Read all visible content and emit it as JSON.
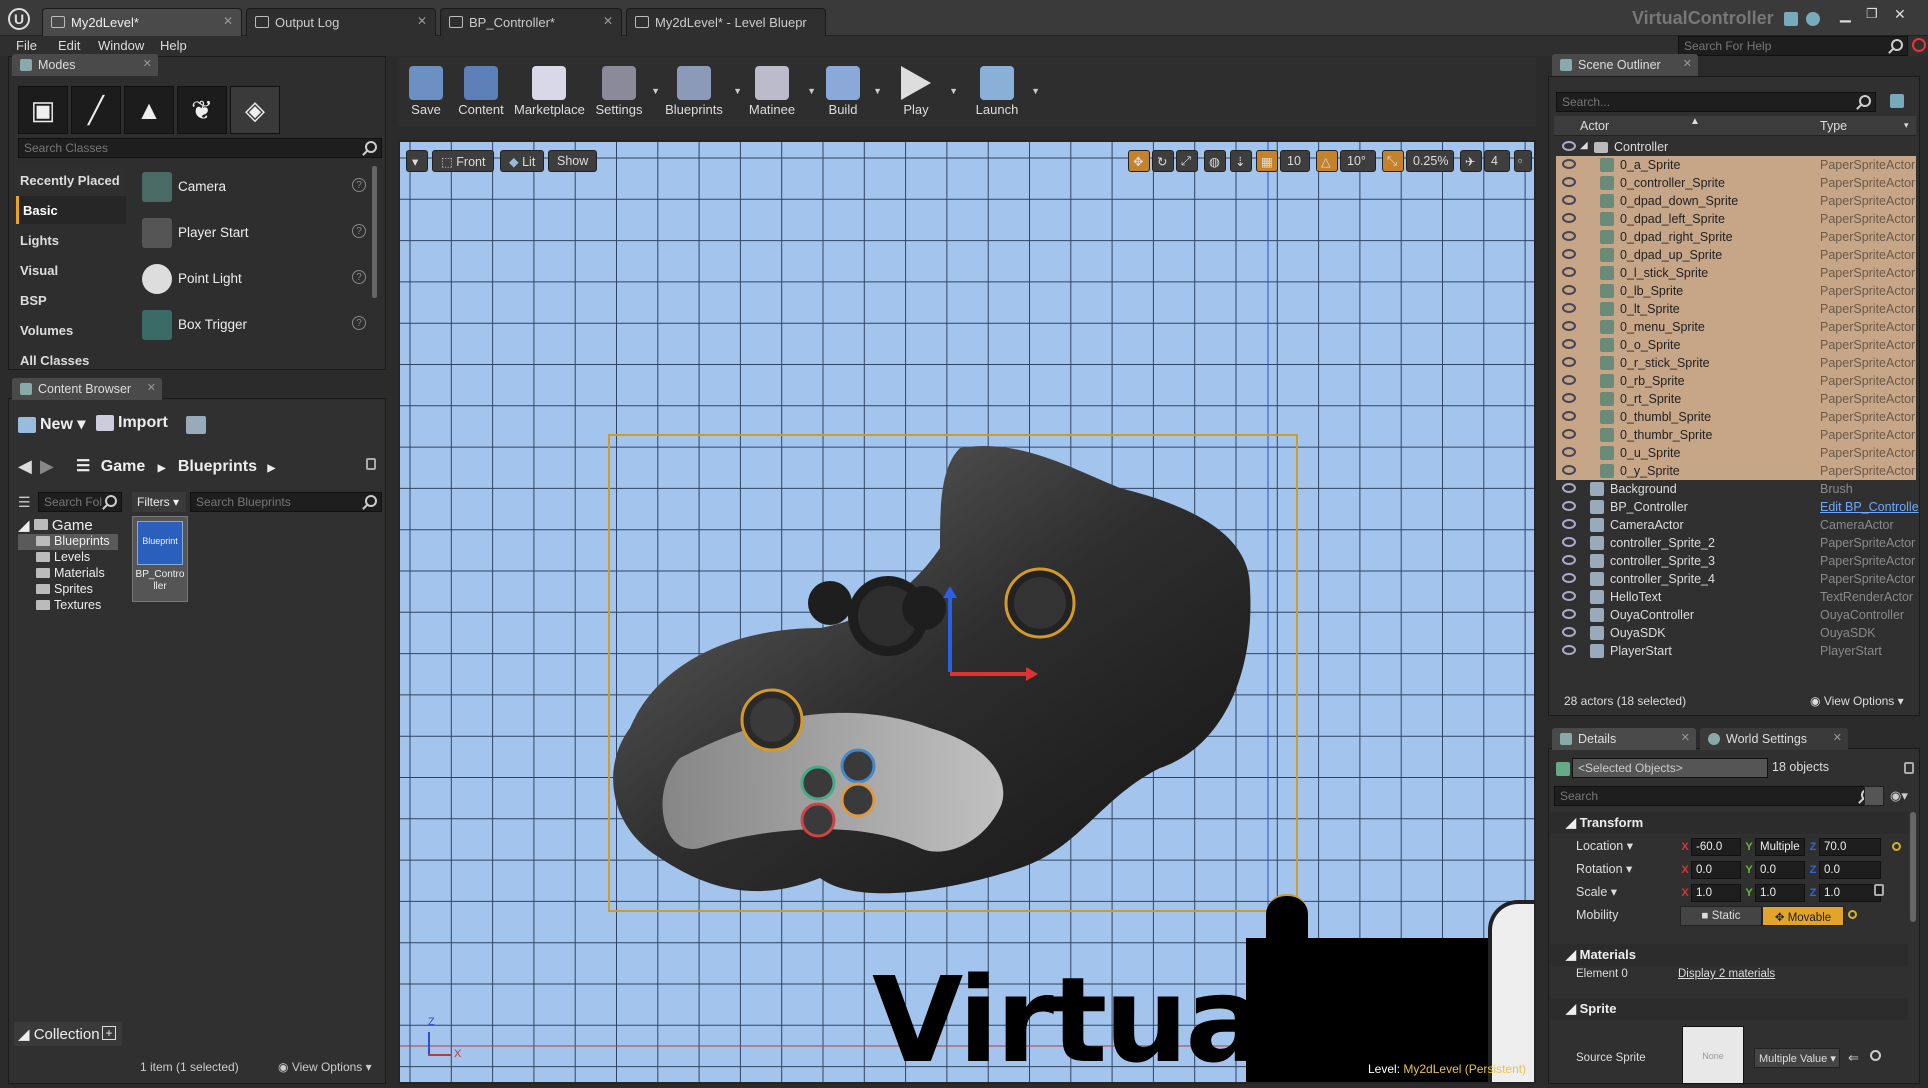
{
  "window": {
    "app_title": "VirtualController",
    "tabs": [
      "My2dLevel*",
      "Output Log",
      "BP_Controller*",
      "My2dLevel* - Level Bluepr"
    ],
    "search_help_placeholder": "Search For Help"
  },
  "menu": [
    "File",
    "Edit",
    "Window",
    "Help"
  ],
  "modes": {
    "tab": "Modes",
    "search_placeholder": "Search Classes",
    "categories": [
      "Recently Placed",
      "Basic",
      "Lights",
      "Visual",
      "BSP",
      "Volumes",
      "All Classes"
    ],
    "items": [
      "Camera",
      "Player Start",
      "Point Light",
      "Box Trigger"
    ]
  },
  "content_browser": {
    "tab": "Content Browser",
    "new_label": "New",
    "import_label": "Import",
    "path": [
      "Game",
      "Blueprints"
    ],
    "folder_search_placeholder": "Search Fol",
    "filters_label": "Filters",
    "asset_search_placeholder": "Search Blueprints",
    "tree_root": "Game",
    "tree_items": [
      "Blueprints",
      "Levels",
      "Materials",
      "Sprites",
      "Textures"
    ],
    "asset_type": "Blueprint",
    "asset_name": "BP_Controller",
    "collections_label": "Collection",
    "status": "1 item (1 selected)",
    "view_options": "View Options"
  },
  "toolbar": {
    "buttons": [
      "Save",
      "Content",
      "Marketplace",
      "Settings",
      "Blueprints",
      "Matinee",
      "Build",
      "Play",
      "Launch"
    ]
  },
  "viewport": {
    "view_mode": "Front",
    "lighting": "Lit",
    "show": "Show",
    "grid_snap": "10",
    "rotation_snap": "10°",
    "scale_snap": "0.25%",
    "camera_speed": "4",
    "overlay_text": "Virtual",
    "level_label": "Level:",
    "level_name": "My2dLevel (Persistent)",
    "axis_z": "Z",
    "axis_x": "X"
  },
  "outliner": {
    "tab": "Scene Outliner",
    "search_placeholder": "Search...",
    "col_actor": "Actor",
    "col_type": "Type",
    "folder": "Controller",
    "rows": [
      {
        "name": "0_a_Sprite",
        "type": "PaperSpriteActor",
        "selected": true
      },
      {
        "name": "0_controller_Sprite",
        "type": "PaperSpriteActor",
        "selected": true
      },
      {
        "name": "0_dpad_down_Sprite",
        "type": "PaperSpriteActor",
        "selected": true
      },
      {
        "name": "0_dpad_left_Sprite",
        "type": "PaperSpriteActor",
        "selected": true
      },
      {
        "name": "0_dpad_right_Sprite",
        "type": "PaperSpriteActor",
        "selected": true
      },
      {
        "name": "0_dpad_up_Sprite",
        "type": "PaperSpriteActor",
        "selected": true
      },
      {
        "name": "0_l_stick_Sprite",
        "type": "PaperSpriteActor",
        "selected": true
      },
      {
        "name": "0_lb_Sprite",
        "type": "PaperSpriteActor",
        "selected": true
      },
      {
        "name": "0_lt_Sprite",
        "type": "PaperSpriteActor",
        "selected": true
      },
      {
        "name": "0_menu_Sprite",
        "type": "PaperSpriteActor",
        "selected": true
      },
      {
        "name": "0_o_Sprite",
        "type": "PaperSpriteActor",
        "selected": true
      },
      {
        "name": "0_r_stick_Sprite",
        "type": "PaperSpriteActor",
        "selected": true
      },
      {
        "name": "0_rb_Sprite",
        "type": "PaperSpriteActor",
        "selected": true
      },
      {
        "name": "0_rt_Sprite",
        "type": "PaperSpriteActor",
        "selected": true
      },
      {
        "name": "0_thumbl_Sprite",
        "type": "PaperSpriteActor",
        "selected": true
      },
      {
        "name": "0_thumbr_Sprite",
        "type": "PaperSpriteActor",
        "selected": true
      },
      {
        "name": "0_u_Sprite",
        "type": "PaperSpriteActor",
        "selected": true
      },
      {
        "name": "0_y_Sprite",
        "type": "PaperSpriteActor",
        "selected": true
      },
      {
        "name": "Background",
        "type": "Brush",
        "selected": false
      },
      {
        "name": "BP_Controller",
        "type": "Edit BP_Controlle",
        "selected": false,
        "link": true
      },
      {
        "name": "CameraActor",
        "type": "CameraActor",
        "selected": false
      },
      {
        "name": "controller_Sprite_2",
        "type": "PaperSpriteActor",
        "selected": false
      },
      {
        "name": "controller_Sprite_3",
        "type": "PaperSpriteActor",
        "selected": false
      },
      {
        "name": "controller_Sprite_4",
        "type": "PaperSpriteActor",
        "selected": false
      },
      {
        "name": "HelloText",
        "type": "TextRenderActor",
        "selected": false
      },
      {
        "name": "OuyaController",
        "type": "OuyaController",
        "selected": false
      },
      {
        "name": "OuyaSDK",
        "type": "OuyaSDK",
        "selected": false
      },
      {
        "name": "PlayerStart",
        "type": "PlayerStart",
        "selected": false
      }
    ],
    "status": "28 actors (18 selected)",
    "view_options": "View Options"
  },
  "details": {
    "tab": "Details",
    "tab2": "World Settings",
    "selected_placeholder": "<Selected Objects>",
    "count": "18 objects",
    "search_placeholder": "Search",
    "transform_header": "Transform",
    "location_label": "Location",
    "rotation_label": "Rotation",
    "scale_label": "Scale",
    "mobility_label": "Mobility",
    "location": [
      "-60.0",
      "Multiple",
      "70.0"
    ],
    "rotation": [
      "0.0",
      "0.0",
      "0.0"
    ],
    "scale": [
      "1.0",
      "1.0",
      "1.0"
    ],
    "static_label": "Static",
    "movable_label": "Movable",
    "materials_header": "Materials",
    "element_label": "Element 0",
    "element_value": "Display 2 materials",
    "sprite_header": "Sprite",
    "source_sprite_label": "Source Sprite",
    "source_sprite_thumb": "None",
    "source_sprite_value": "Multiple Value"
  },
  "colors": {
    "accent_orange": "#e8a322",
    "selection_row": "#c7a587",
    "viewport_bg": "#a3c4ec",
    "link": "#6fa8ff"
  }
}
